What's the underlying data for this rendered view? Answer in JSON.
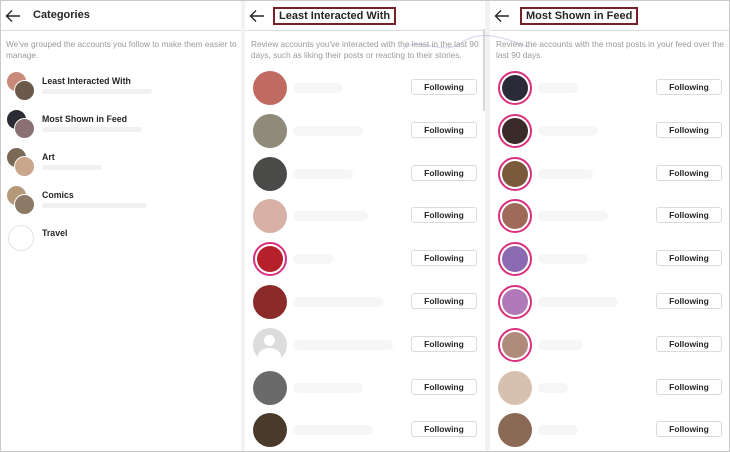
{
  "panels": {
    "categories": {
      "title": "Categories",
      "description": "We've grouped the accounts you follow to make them easier to manage.",
      "items": [
        {
          "label": "Least Interacted With",
          "c1": "#c98a7a",
          "c2": "#6b5a4a"
        },
        {
          "label": "Most Shown in Feed",
          "c1": "#2b2b35",
          "c2": "#8a7070"
        },
        {
          "label": "Art",
          "c1": "#7a6a55",
          "c2": "#c9a58c"
        },
        {
          "label": "Comics",
          "c1": "#b59a7a",
          "c2": "#8c7a66"
        },
        {
          "label": "Travel",
          "c1": "#ffffff",
          "c2": "#ffffff"
        }
      ]
    },
    "least": {
      "title": "Least Interacted With",
      "description": "Review accounts you've interacted with the least in the last 90 days, such as liking their posts or reacting to their stories.",
      "button_label": "Following",
      "avatars": [
        {
          "color": "#c06a62",
          "ring": false
        },
        {
          "color": "#8f8a7a",
          "ring": false
        },
        {
          "color": "#4a4a48",
          "ring": false
        },
        {
          "color": "#d9b0a6",
          "ring": false
        },
        {
          "color": "#b5202a",
          "ring": true
        },
        {
          "color": "#8c2a2a",
          "ring": false
        },
        {
          "color": "generic",
          "ring": false
        },
        {
          "color": "#6a6a6a",
          "ring": false
        },
        {
          "color": "#4a3a2a",
          "ring": false
        }
      ]
    },
    "most": {
      "title": "Most Shown in Feed",
      "description": "Review the accounts with the most posts in your feed over the last 90 days.",
      "button_label": "Following",
      "avatars": [
        {
          "color": "#2a2a38",
          "ring": true
        },
        {
          "color": "#3a2a2a",
          "ring": true
        },
        {
          "color": "#7a5a3a",
          "ring": true
        },
        {
          "color": "#a06a5a",
          "ring": true
        },
        {
          "color": "#8a6ab0",
          "ring": true
        },
        {
          "color": "#b07ab8",
          "ring": true
        },
        {
          "color": "#b08a7a",
          "ring": true
        },
        {
          "color": "#d8c0b0",
          "ring": false
        },
        {
          "color": "#8a6a55",
          "ring": false
        }
      ]
    }
  }
}
